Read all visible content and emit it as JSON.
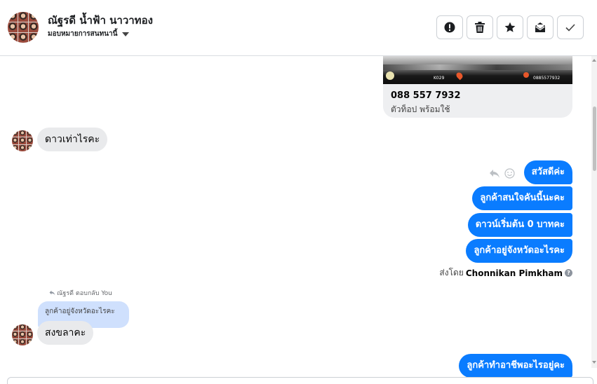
{
  "header": {
    "contact_name": "ณัฐรดี น้ำฟ้า นาวาทอง",
    "assign_label": "มอบหมายการสนทนานี้",
    "actions": [
      {
        "icon": "alert-icon",
        "name": "mark-spam-button"
      },
      {
        "icon": "trash-icon",
        "name": "delete-button"
      },
      {
        "icon": "star-icon",
        "name": "star-button"
      },
      {
        "icon": "mark-unread-icon",
        "name": "mark-unread-button"
      },
      {
        "icon": "check-icon",
        "name": "mark-done-button"
      }
    ]
  },
  "card": {
    "image_texts": [
      "K029",
      "0885577932"
    ],
    "phone": "088 557 7932",
    "subtitle": "ตัวท็อป พร้อมใช้"
  },
  "messages": {
    "in_1": "ดาวเท่าไรคะ",
    "out_1": "สวัสดีค่ะ",
    "out_2": "ลูกค้าสนใจคันนี้นะคะ",
    "out_3": "ดาวน์เริ่มต้น 0 บาทคะ",
    "out_4": "ลูกค้าอยู่จังหวัดอะไรคะ",
    "sent_by_prefix": "ส่งโดย",
    "sent_by_name": "Chonnikan Pimkham",
    "reply_meta": "ณัฐรดี ตอบกลับ You",
    "quoted_text": "ลูกค้าอยู่จังหวัดอะไรคะ",
    "in_2": "สงขลาคะ",
    "out_5": "ลูกค้าทำอาชีพอะไรอยู่คะ"
  },
  "colors": {
    "outgoing_bubble": "#0a7cff",
    "incoming_bubble": "#e9eaec",
    "quoted_bubble": "#cfe0fd",
    "border": "#dadde1"
  }
}
